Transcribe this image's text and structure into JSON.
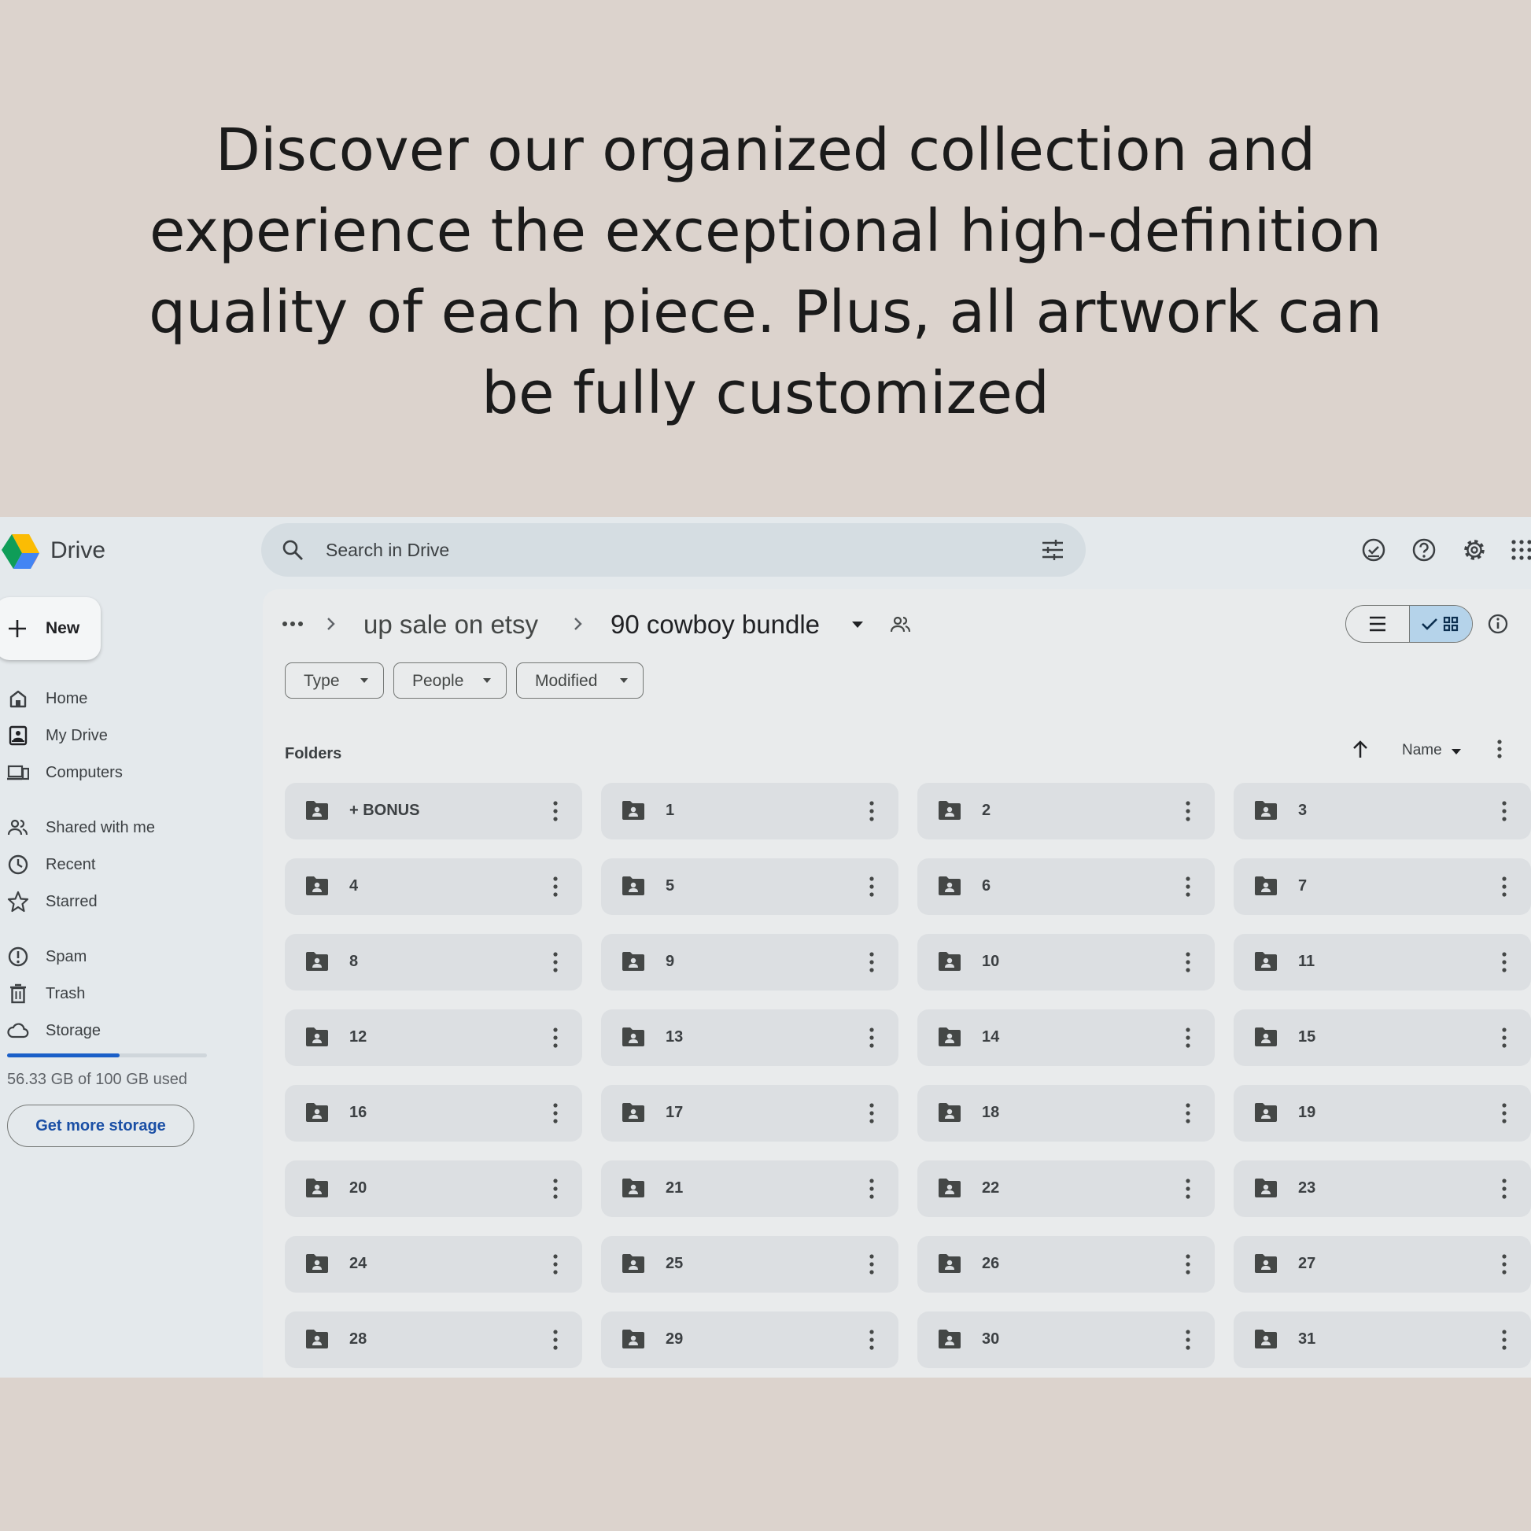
{
  "headline": [
    "Discover our organized collection and",
    "experience the exceptional high-definition",
    "quality of each piece. Plus, all artwork can",
    "be fully customized"
  ],
  "app": {
    "name": "Drive"
  },
  "search": {
    "placeholder": "Search in Drive"
  },
  "sidebar": {
    "new_label": "New",
    "items": [
      {
        "label": "Home",
        "icon": "home-icon"
      },
      {
        "label": "My Drive",
        "icon": "my-drive-icon"
      },
      {
        "label": "Computers",
        "icon": "computers-icon"
      },
      {
        "label": "Shared with me",
        "icon": "shared-icon"
      },
      {
        "label": "Recent",
        "icon": "clock-icon"
      },
      {
        "label": "Starred",
        "icon": "star-icon"
      },
      {
        "label": "Spam",
        "icon": "spam-icon"
      },
      {
        "label": "Trash",
        "icon": "trash-icon"
      },
      {
        "label": "Storage",
        "icon": "cloud-icon"
      }
    ],
    "storage": {
      "used_fraction": 0.5633,
      "text": "56.33 GB of 100 GB used",
      "button": "Get more storage"
    }
  },
  "breadcrumb": {
    "parent": "up sale on etsy",
    "current": "90 cowboy bundle"
  },
  "filters": [
    "Type",
    "People",
    "Modified"
  ],
  "section": {
    "label": "Folders",
    "sort_label": "Name"
  },
  "folders": [
    "+ BONUS",
    "1",
    "2",
    "3",
    "4",
    "5",
    "6",
    "7",
    "8",
    "9",
    "10",
    "11",
    "12",
    "13",
    "14",
    "15",
    "16",
    "17",
    "18",
    "19",
    "20",
    "21",
    "22",
    "23",
    "24",
    "25",
    "26",
    "27",
    "28",
    "29",
    "30",
    "31"
  ],
  "colors": {
    "background": "#dcd3cd",
    "screen": "#e4e9ec",
    "accent": "#1a5fc8",
    "toggle_active": "#b5d3ea"
  }
}
